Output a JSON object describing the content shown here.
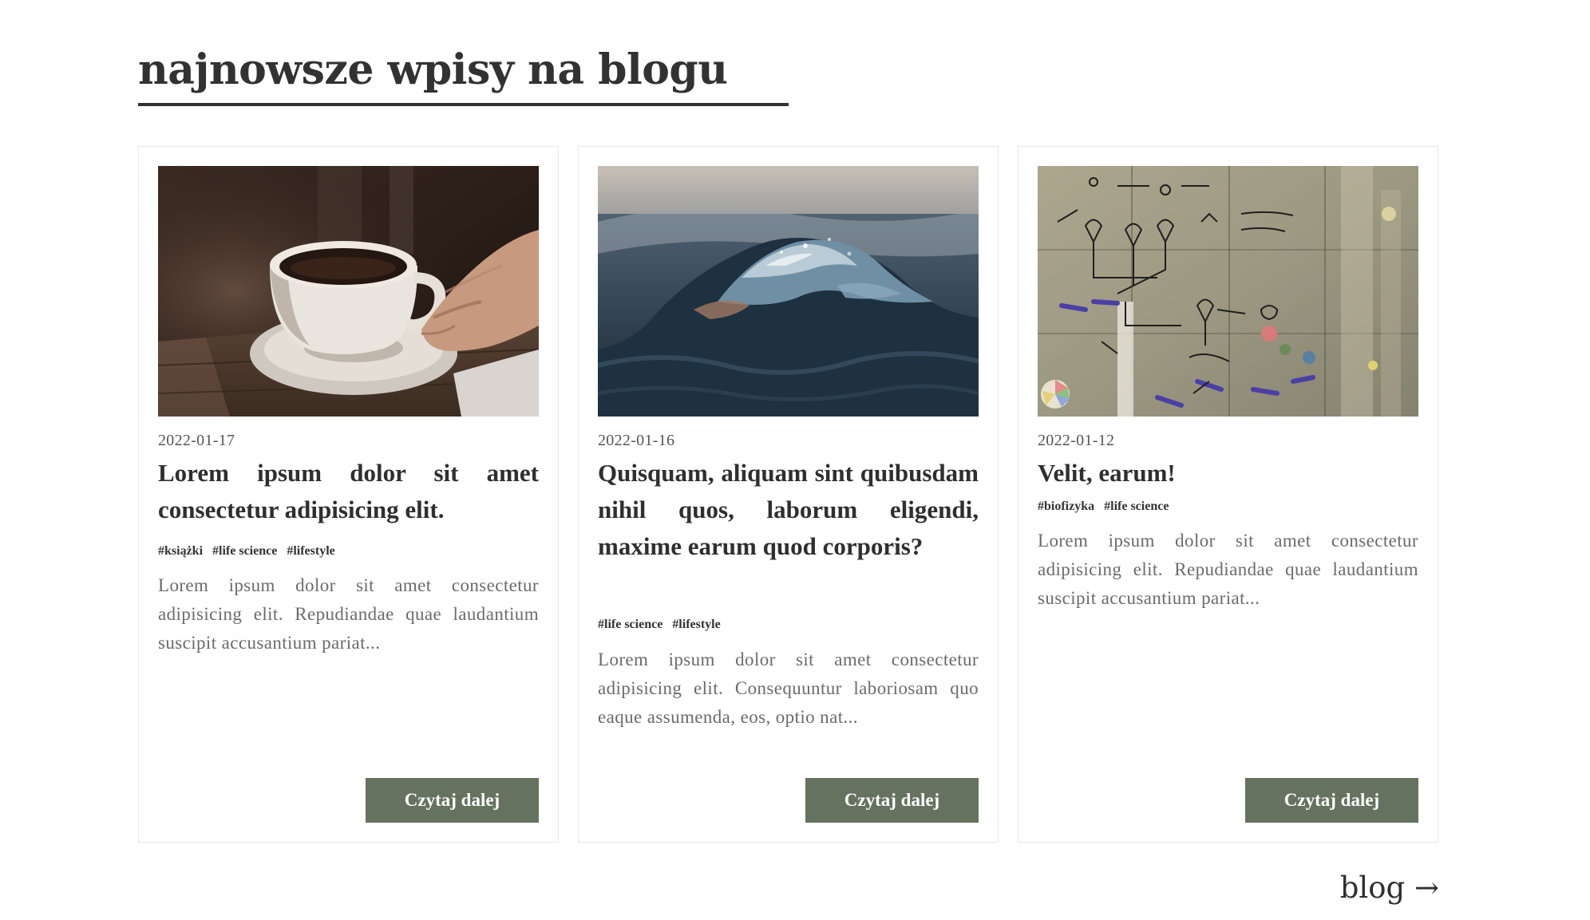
{
  "section": {
    "title": "najnowsze wpisy na blogu"
  },
  "cards": [
    {
      "date": "2022-01-17",
      "title": "Lorem ipsum dolor sit amet consectetur adipisicing elit.",
      "tags": [
        "#książki",
        "#life science",
        "#lifestyle"
      ],
      "excerpt": "Lorem ipsum dolor sit amet consectetur adipisicing elit. Repudiandae quae laudantium suscipit accusantium pariat...",
      "button_label": "Czytaj dalej",
      "image_subject": "coffee-cup"
    },
    {
      "date": "2022-01-16",
      "title": "Quisquam, aliquam sint quibusdam nihil quos, laborum eligendi, maxime earum quod corporis?",
      "tags": [
        "#life science",
        "#lifestyle"
      ],
      "excerpt": "Lorem ipsum dolor sit amet consectetur adipisicing elit. Consequuntur laboriosam quo eaque assumenda, eos, optio nat...",
      "button_label": "Czytaj dalej",
      "image_subject": "ocean-wave"
    },
    {
      "date": "2022-01-12",
      "title": "Velit, earum!",
      "tags": [
        "#biofizyka",
        "#life science"
      ],
      "excerpt": "Lorem ipsum dolor sit amet consectetur adipisicing elit. Repudiandae quae laudantium suscipit accusantium pariat...",
      "button_label": "Czytaj dalej",
      "image_subject": "lab-glass-board"
    }
  ],
  "footer_link": {
    "label": "blog",
    "arrow": "→"
  },
  "colors": {
    "button_bg": "#65725f",
    "title_text": "#323232",
    "excerpt_text": "#6b6b6b"
  }
}
